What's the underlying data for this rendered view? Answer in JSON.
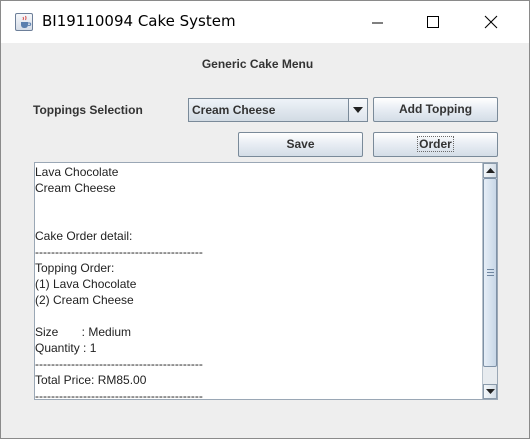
{
  "window": {
    "title": "BI19110094 Cake System"
  },
  "menu": {
    "heading": "Generic Cake Menu",
    "toppings_label": "Toppings Selection",
    "topping_selected": "Cream Cheese",
    "add_topping_label": "Add Topping",
    "save_label": "Save",
    "order_label": "Order"
  },
  "output": {
    "lines": [
      "Lava Chocolate",
      "Cream Cheese",
      "",
      "",
      "Cake Order detail:",
      "------------------------------------------",
      "Topping Order:",
      "(1) Lava Chocolate",
      "(2) Cream Cheese",
      "",
      "Size       : Medium",
      "Quantity : 1",
      "------------------------------------------",
      "Total Price: RM85.00",
      "------------------------------------------"
    ]
  },
  "icons": {
    "app": "java-cup-icon",
    "minimize": "minimize-icon",
    "maximize": "maximize-icon",
    "close": "close-icon",
    "dropdown": "chevron-down-icon",
    "scroll_up": "arrow-up-icon",
    "scroll_down": "arrow-down-icon"
  }
}
